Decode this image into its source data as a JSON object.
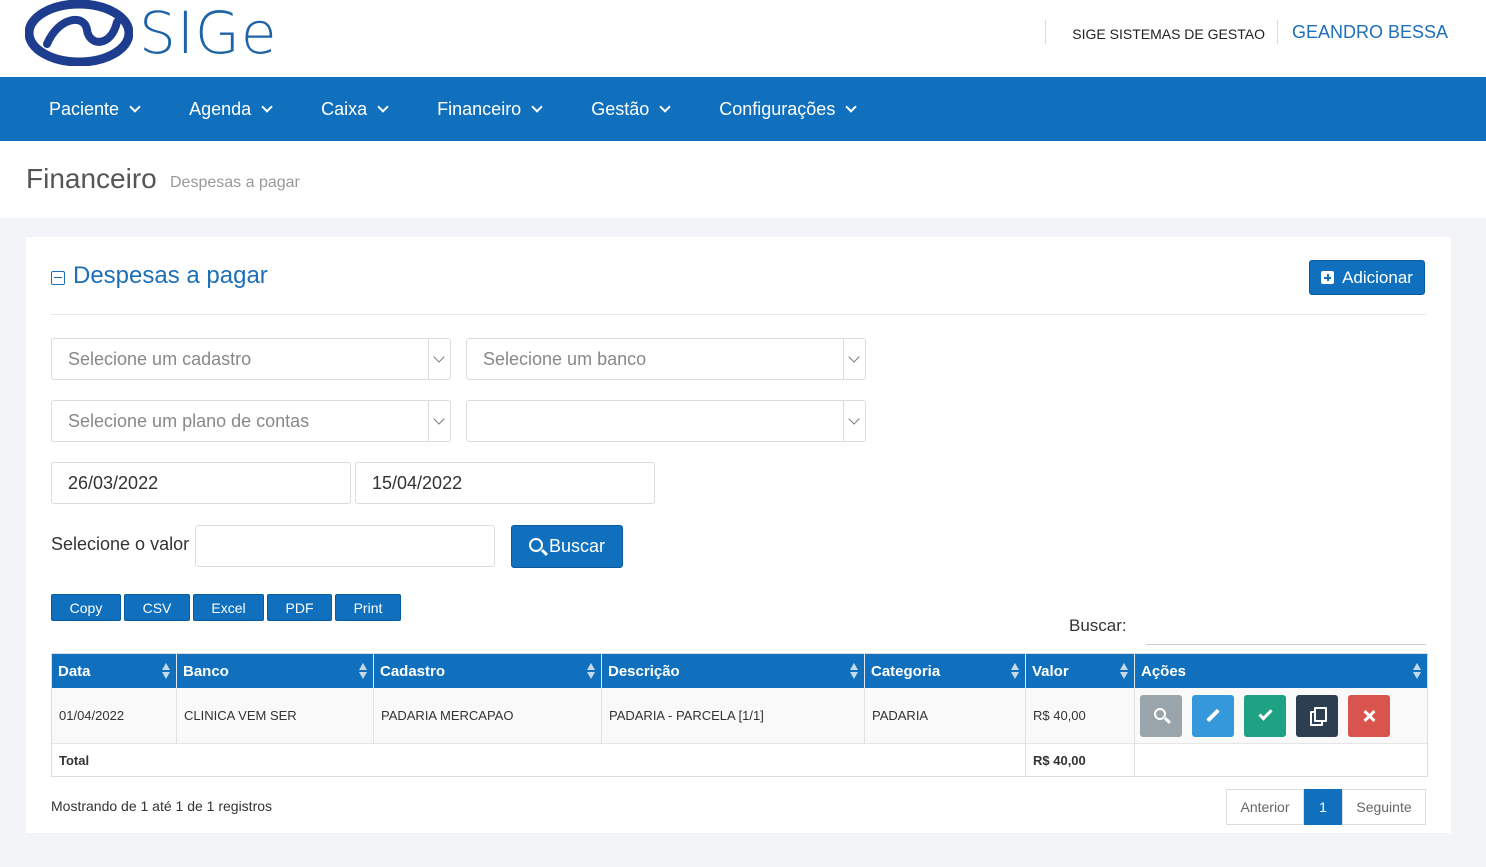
{
  "header": {
    "logo_text": "SIGe",
    "company": "SIGE SISTEMAS DE GESTAO",
    "user": "GEANDRO BESSA"
  },
  "nav": {
    "items": [
      {
        "label": "Paciente"
      },
      {
        "label": "Agenda"
      },
      {
        "label": "Caixa"
      },
      {
        "label": "Financeiro"
      },
      {
        "label": "Gestão"
      },
      {
        "label": "Configurações"
      }
    ]
  },
  "page": {
    "title": "Financeiro",
    "subtitle": "Despesas a pagar"
  },
  "panel": {
    "title": "Despesas a pagar",
    "add_label": "Adicionar"
  },
  "filters": {
    "cadastro_placeholder": "Selecione um cadastro",
    "banco_placeholder": "Selecione um banco",
    "plano_placeholder": "Selecione um plano de contas",
    "extra_value": "",
    "date_from": "26/03/2022",
    "date_to": "15/04/2022",
    "valor_label": "Selecione o valor",
    "valor_value": "",
    "search_button": "Buscar"
  },
  "export": {
    "buttons": [
      "Copy",
      "CSV",
      "Excel",
      "PDF",
      "Print"
    ]
  },
  "table_search": {
    "label": "Buscar:",
    "value": ""
  },
  "table": {
    "columns": [
      "Data",
      "Banco",
      "Cadastro",
      "Descrição",
      "Categoria",
      "Valor",
      "Ações"
    ],
    "rows": [
      {
        "data": "01/04/2022",
        "banco": "CLINICA VEM SER",
        "cadastro": "PADARIA MERCAPAO",
        "descricao": "PADARIA - PARCELA [1/1]",
        "categoria": "PADARIA",
        "valor": "R$ 40,00",
        "actions": [
          "search-icon",
          "pencil-icon",
          "check-icon",
          "copy-icon",
          "close-icon"
        ]
      }
    ],
    "footer": {
      "label": "Total",
      "total": "R$ 40,00"
    }
  },
  "info": "Mostrando de 1 até 1 de 1 registros",
  "pagination": {
    "prev": "Anterior",
    "current": "1",
    "next": "Seguinte"
  },
  "colors": {
    "primary": "#1070bd",
    "view": "#9aa5ab",
    "edit": "#3498db",
    "ok": "#1fa283",
    "copy": "#2c3e50",
    "delete": "#d9534f"
  }
}
